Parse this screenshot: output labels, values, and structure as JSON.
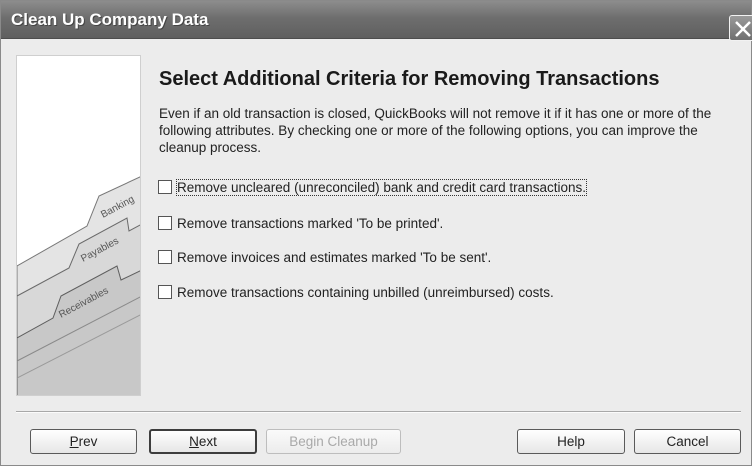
{
  "window": {
    "title": "Clean Up Company Data"
  },
  "side_panel": {
    "tabs": [
      "Banking",
      "Payables",
      "Receivables"
    ]
  },
  "content": {
    "heading": "Select Additional Criteria for Removing Transactions",
    "description": "Even if an old transaction is closed, QuickBooks will not remove it if it has one or more of the following attributes.  By checking one or more of the following options, you can improve the cleanup process."
  },
  "options": [
    {
      "label": "Remove uncleared (unreconciled) bank and credit card transactions.",
      "checked": false
    },
    {
      "label": "Remove transactions marked 'To be printed'.",
      "checked": false
    },
    {
      "label": "Remove invoices and estimates marked 'To be sent'.",
      "checked": false
    },
    {
      "label": "Remove transactions containing unbilled (unreimbursed) costs.",
      "checked": false
    }
  ],
  "buttons": {
    "prev": "Prev",
    "next": "Next",
    "begin_cleanup": "Begin Cleanup",
    "help": "Help",
    "cancel": "Cancel"
  }
}
